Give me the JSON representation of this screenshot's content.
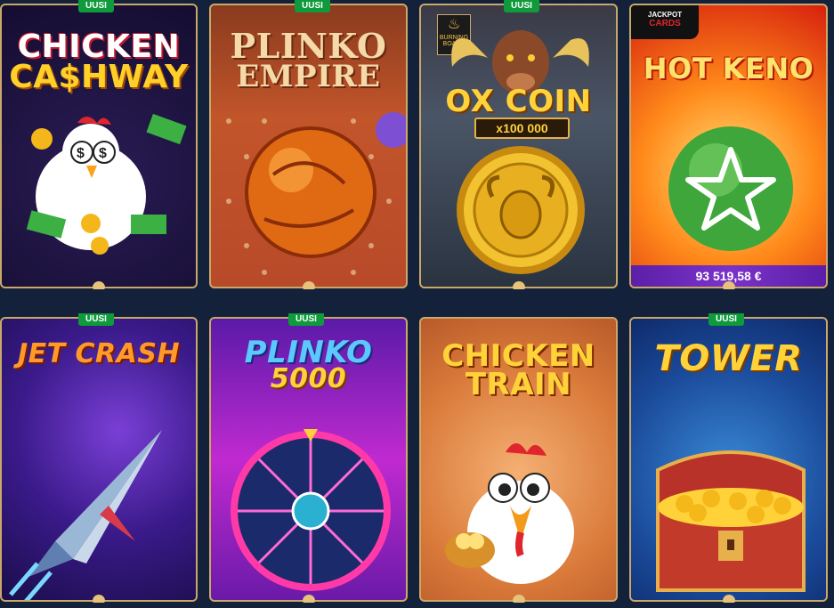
{
  "colors": {
    "background": "#13213a",
    "frame": "#c9a86a",
    "badge": "#0f9a3c",
    "jackpot_bar": "#6a2bb8"
  },
  "games": [
    {
      "title_line1": "CHICKEN",
      "title_line2": "CA$HWAY",
      "badge": "UUSI"
    },
    {
      "title_line1": "PLINKO",
      "title_line2": "EMPIRE",
      "badge": "UUSI"
    },
    {
      "brand_line1": "BURNING",
      "brand_line2": "BOARD",
      "title": "OX COIN",
      "multiplier": "x100 000",
      "badge": "UUSI"
    },
    {
      "brand_line1": "JACKPOT",
      "brand_line2": "CARDS",
      "title": "HOT KENO",
      "jackpot": "93 519,58 €"
    },
    {
      "title": "JET CRASH",
      "badge": "UUSI"
    },
    {
      "title_line1": "PLINKO",
      "title_line2": "5000",
      "badge": "UUSI"
    },
    {
      "title_line1": "CHICKEN",
      "title_line2": "TRAIN"
    },
    {
      "title": "TOWER",
      "badge": "UUSI"
    }
  ]
}
